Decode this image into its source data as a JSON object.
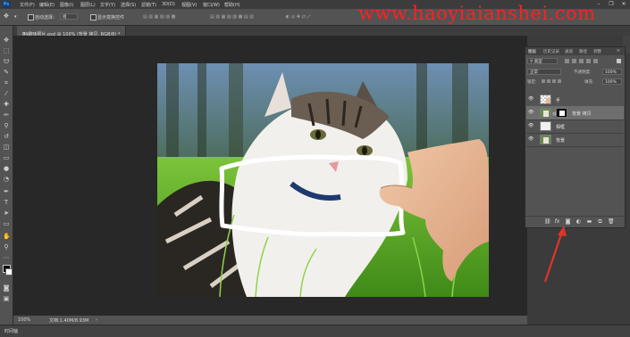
{
  "app": {
    "logo": "Ps"
  },
  "menubar": {
    "items": [
      "文件(F)",
      "编辑(E)",
      "图像(I)",
      "图层(L)",
      "文字(Y)",
      "选择(S)",
      "滤镜(T)",
      "3D(D)",
      "视图(V)",
      "窗口(W)",
      "帮助(H)"
    ]
  },
  "window_controls": {
    "minimize": "–",
    "restore": "❐",
    "close": "✕"
  },
  "watermark": "www.haoyiaianshei.com",
  "options": {
    "auto_select": "自动选择：",
    "group": "组",
    "show_transform": "显示变换控件"
  },
  "document": {
    "tab_title": "04趣味照片.psd @ 100% (背景 拷贝, RGB/8) *",
    "tab_close": "×"
  },
  "status": {
    "zoom": "100%",
    "doc_info": "文档:1.40M/8.93M"
  },
  "timeline": {
    "label": "时间轴"
  },
  "panel_tabs": [
    "图层",
    "历史记录",
    "通道",
    "路径",
    "调整"
  ],
  "layers_panel": {
    "filter_label": "类型",
    "blend_mode": "正常",
    "opacity_label": "不透明度:",
    "opacity_value": "100%",
    "lock_label": "锁定:",
    "fill_label": "填充:",
    "fill_value": "100%",
    "layers": [
      {
        "name": "手",
        "thumb": "hand",
        "selected": false,
        "mask": false
      },
      {
        "name": "背景 拷贝",
        "thumb": "cat",
        "selected": true,
        "mask": true
      },
      {
        "name": "相框",
        "thumb": "white",
        "selected": false,
        "mask": false
      },
      {
        "name": "背景",
        "thumb": "cat",
        "selected": false,
        "mask": false
      }
    ],
    "footer_icons": [
      "link-icon",
      "fx-icon",
      "add-mask-icon",
      "adjustment-icon",
      "folder-icon",
      "new-layer-icon",
      "trash-icon"
    ]
  },
  "tools": [
    "move-tool",
    "marquee-tool",
    "lasso-tool",
    "quick-select-tool",
    "crop-tool",
    "eyedropper-tool",
    "healing-brush-tool",
    "brush-tool",
    "clone-stamp-tool",
    "history-brush-tool",
    "eraser-tool",
    "gradient-tool",
    "blur-tool",
    "dodge-tool",
    "pen-tool",
    "type-tool",
    "path-select-tool",
    "shape-tool",
    "hand-tool",
    "zoom-tool",
    "more-tools",
    "color-swatches",
    "quick-mask-tool",
    "screen-mode-tool"
  ],
  "colors": {
    "annotation_arrow": "#e0342a",
    "watermark": "#ff2020",
    "panel": "#535353",
    "canvas_bg": "#282828"
  }
}
